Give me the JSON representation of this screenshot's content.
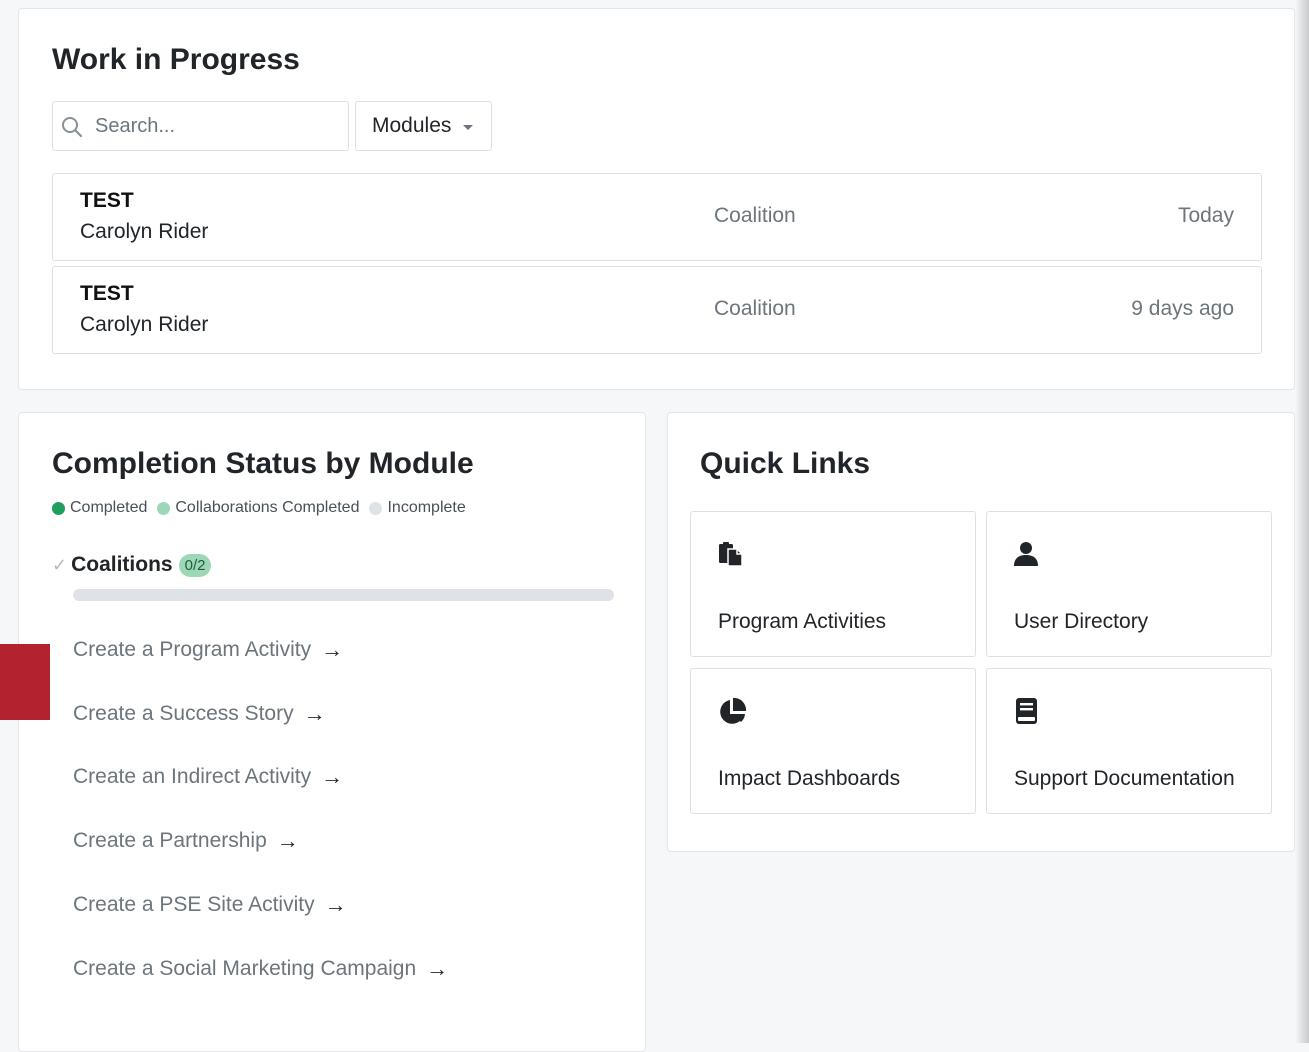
{
  "wip": {
    "title": "Work in Progress",
    "search_placeholder": "Search...",
    "modules_label": "Modules",
    "rows": [
      {
        "title": "TEST",
        "name": "Carolyn Rider",
        "module": "Coalition",
        "date": "Today"
      },
      {
        "title": "TEST",
        "name": "Carolyn Rider",
        "module": "Coalition",
        "date": "9 days ago"
      }
    ]
  },
  "completion": {
    "title": "Completion Status by Module",
    "legend": [
      {
        "label": "Completed",
        "color": "#1e9e5f"
      },
      {
        "label": "Collaborations Completed",
        "color": "#9ed7b8"
      },
      {
        "label": "Incomplete",
        "color": "#dfe3e8"
      }
    ],
    "module": {
      "name": "Coalitions",
      "badge": "0/2",
      "progress": 0
    },
    "actions": [
      "Create a Program Activity",
      "Create a Success Story",
      "Create an Indirect Activity",
      "Create a Partnership",
      "Create a PSE Site Activity",
      "Create a Social Marketing Campaign"
    ],
    "arrow": "→",
    "check": "✓"
  },
  "quick_links": {
    "title": "Quick Links",
    "items": [
      {
        "label": "Program Activities",
        "icon": "clipboard-icon"
      },
      {
        "label": "User Directory",
        "icon": "user-icon"
      },
      {
        "label": "Impact Dashboards",
        "icon": "pie-chart-icon"
      },
      {
        "label": "Support Documentation",
        "icon": "book-icon"
      }
    ]
  },
  "colors": {
    "accent_red": "#b3222f",
    "completed": "#1e9e5f"
  }
}
